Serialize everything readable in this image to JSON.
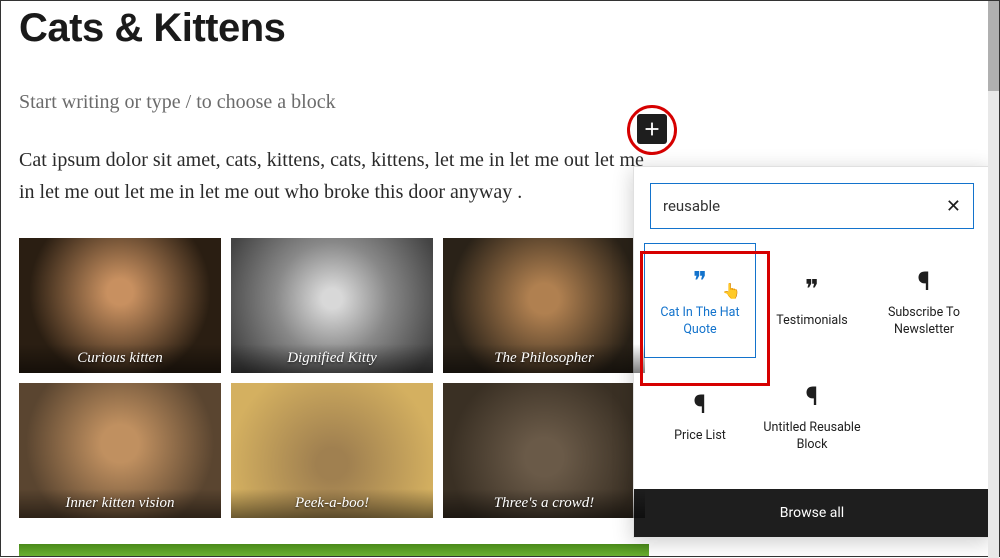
{
  "page": {
    "title": "Cats & Kittens",
    "placeholder": "Start writing or type / to choose a block",
    "paragraph": "Cat ipsum dolor sit amet, cats, kittens, cats, kittens, let me in let me out let me in let me out let me in let me out who broke this door anyway ."
  },
  "gallery": [
    {
      "caption": "Curious kitten"
    },
    {
      "caption": "Dignified Kitty"
    },
    {
      "caption": "The Philosopher"
    },
    {
      "caption": "Inner kitten vision"
    },
    {
      "caption": "Peek-a-boo!"
    },
    {
      "caption": "Three's a crowd!"
    }
  ],
  "inserter": {
    "search_value": "reusable",
    "browse_label": "Browse all",
    "blocks": [
      {
        "label": "Cat In The Hat Quote",
        "icon": "quote"
      },
      {
        "label": "Testimonials",
        "icon": "quote"
      },
      {
        "label": "Subscribe To Newsletter",
        "icon": "pilcrow"
      },
      {
        "label": "Price List",
        "icon": "pilcrow"
      },
      {
        "label": "Untitled Reusable Block",
        "icon": "pilcrow"
      }
    ]
  }
}
